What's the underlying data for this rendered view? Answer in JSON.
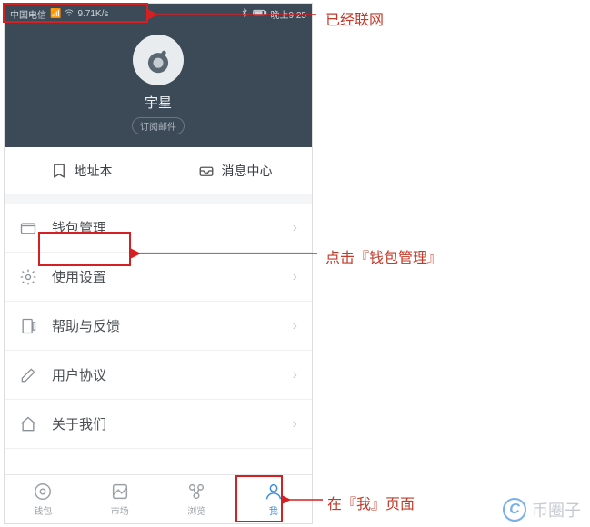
{
  "status": {
    "carrier": "中国电信",
    "speed": "9.71K/s",
    "time": "晚上9:25"
  },
  "profile": {
    "username": "宇星",
    "subscribe_label": "订阅邮件"
  },
  "quick": {
    "address_book": "地址本",
    "message_center": "消息中心"
  },
  "menu": {
    "wallet_manage": "钱包管理",
    "settings": "使用设置",
    "help_feedback": "帮助与反馈",
    "user_agreement": "用户协议",
    "about_us": "关于我们"
  },
  "nav": {
    "wallet": "钱包",
    "market": "市场",
    "browse": "浏览",
    "me": "我"
  },
  "annotations": {
    "network": "已经联网",
    "wallet_click": "点击『钱包管理』",
    "me_page": "在『我』页面"
  },
  "watermark": {
    "text": "币圈子"
  }
}
